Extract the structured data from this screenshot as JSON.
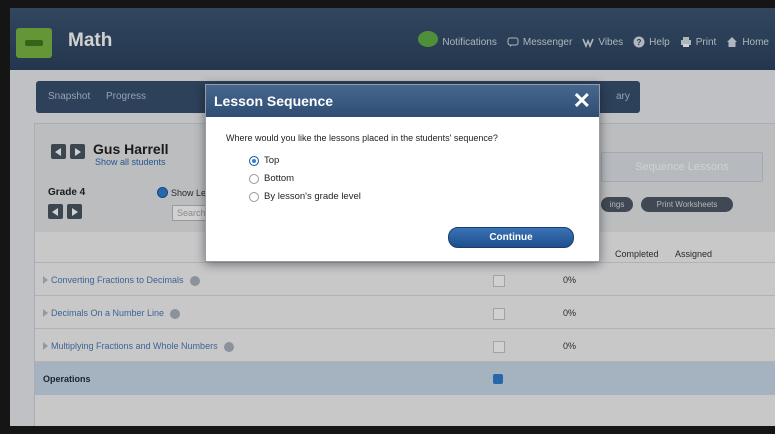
{
  "header": {
    "app_title": "Math",
    "nav": [
      {
        "label": "Notifications",
        "icon": "chat-bubble-icon"
      },
      {
        "label": "Messenger",
        "icon": "message-icon"
      },
      {
        "label": "Vibes",
        "icon": "vibes-icon"
      },
      {
        "label": "Help",
        "icon": "help-icon"
      },
      {
        "label": "Print",
        "icon": "printer-icon"
      },
      {
        "label": "Home",
        "icon": "home-icon"
      }
    ]
  },
  "subnav": {
    "tabs": [
      "Snapshot",
      "Progress"
    ],
    "right_tab": "ary"
  },
  "student": {
    "name": "Gus Harrell",
    "link": "Show all students",
    "grade": "Grade 4",
    "show_label": "Show Les",
    "search_placeholder": "Search t",
    "sequence_button": "Sequence Lessons",
    "pills": [
      "ings",
      "Print Worksheets"
    ]
  },
  "table": {
    "columns": [
      "Completed",
      "Assigned"
    ],
    "rows": [
      {
        "title": "Converting Fractions to Decimals",
        "pct": "0%"
      },
      {
        "title": "Decimals On a Number Line",
        "pct": "0%"
      },
      {
        "title": "Multiplying Fractions and Whole Numbers",
        "pct": "0%"
      }
    ],
    "section": "Operations"
  },
  "modal": {
    "title": "Lesson Sequence",
    "close": "✕",
    "question": "Where would you like the lessons placed in the students' sequence?",
    "options": [
      "Top",
      "Bottom",
      "By lesson's grade level"
    ],
    "selected": "Top",
    "continue_label": "Continue"
  },
  "colors": {
    "header_bg": "#2c4360",
    "accent": "#2f7fd0",
    "logo_green": "#7bb642"
  }
}
